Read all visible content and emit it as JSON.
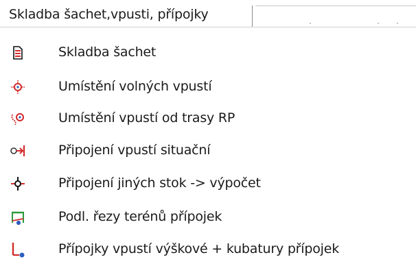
{
  "menu": {
    "title": "Skladba šachet,vpusti, přípojky",
    "items": [
      {
        "label": "Skladba šachet",
        "icon": "shaft-composition-icon"
      },
      {
        "label": "Umístění volných vpustí",
        "icon": "free-inlet-placement-icon"
      },
      {
        "label": "Umístění vpustí od trasy RP",
        "icon": "inlet-route-placement-icon"
      },
      {
        "label": "Připojení vpustí situační",
        "icon": "inlet-connection-plan-icon"
      },
      {
        "label": "Připojení jiných stok -> výpočet",
        "icon": "sewer-connection-icon"
      },
      {
        "label": "Podl. řezy terénů přípojek",
        "icon": "terrain-profile-icon"
      },
      {
        "label": "Přípojky vpustí výškové + kubatury přípojek",
        "icon": "connection-volume-icon"
      }
    ]
  },
  "colors": {
    "text": "#1a1a1a",
    "accent_red": "#d42a2a",
    "accent_blue": "#2d5fbf",
    "accent_green": "#2c9a3a"
  }
}
